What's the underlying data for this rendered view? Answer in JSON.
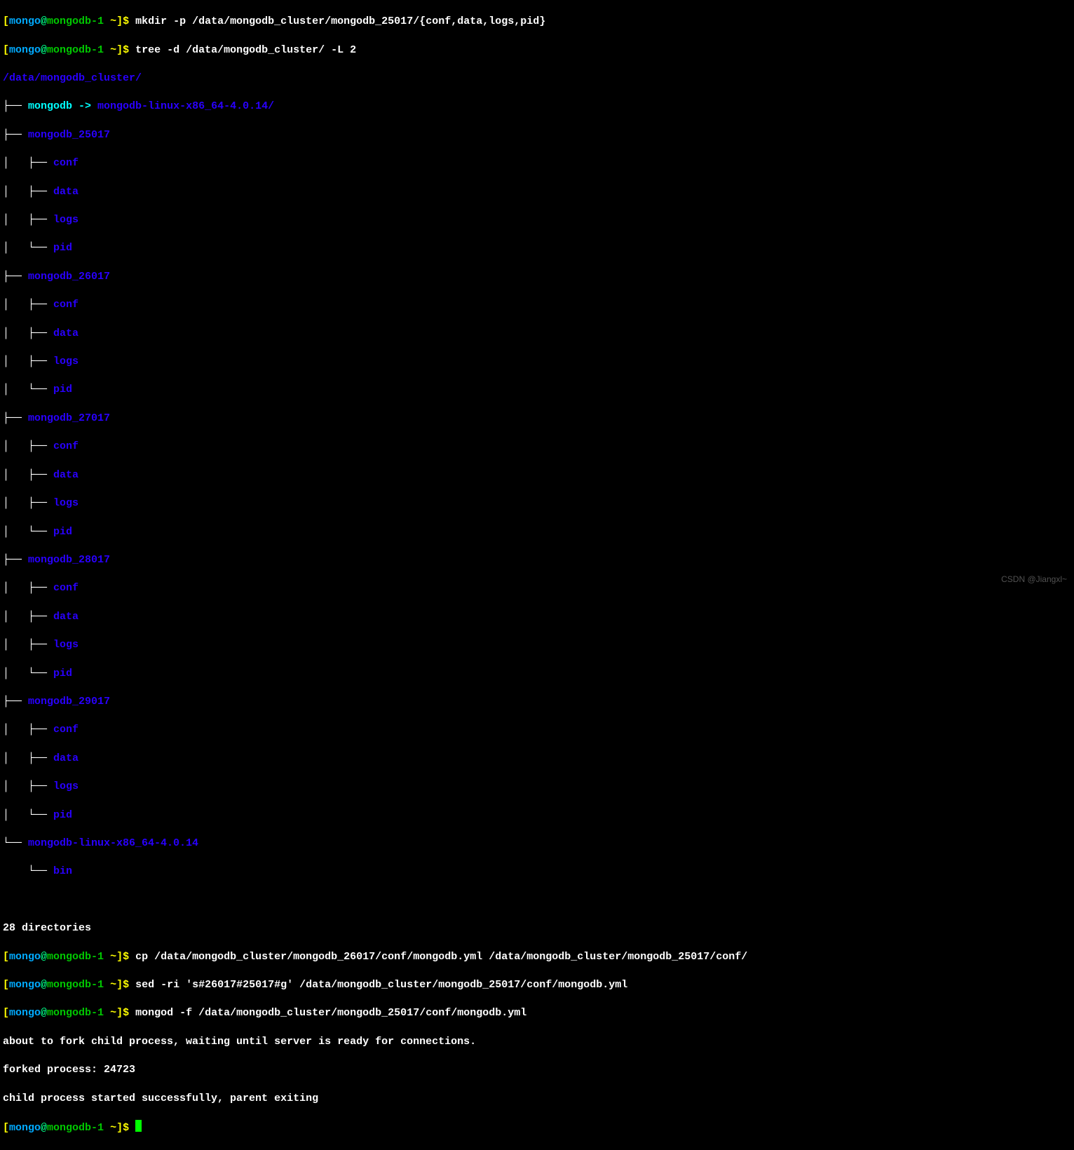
{
  "prompt": {
    "open_bracket": "[",
    "user": "mongo",
    "at": "@",
    "host": "mongodb-1",
    "path": " ~",
    "close_bracket": "]",
    "dollar": "$"
  },
  "commands": {
    "mkdir": "mkdir -p /data/mongodb_cluster/mongodb_25017/{conf,data,logs,pid}",
    "tree": "tree -d /data/mongodb_cluster/ -L 2",
    "cp": "cp /data/mongodb_cluster/mongodb_26017/conf/mongodb.yml /data/mongodb_cluster/mongodb_25017/conf/",
    "sed": "sed -ri 's#26017#25017#g' /data/mongodb_cluster/mongodb_25017/conf/mongodb.yml",
    "mongod": "mongod -f /data/mongodb_cluster/mongodb_25017/conf/mongodb.yml"
  },
  "tree_output": {
    "root": "/data/mongodb_cluster/",
    "symlink_name": "mongodb",
    "symlink_arrow": " -> ",
    "symlink_target": "mongodb-linux-x86_64-4.0.14/",
    "dir1": "mongodb_25017",
    "dir2": "mongodb_26017",
    "dir3": "mongodb_27017",
    "dir4": "mongodb_28017",
    "dir5": "mongodb_29017",
    "dir6": "mongodb-linux-x86_64-4.0.14",
    "sub_conf": "conf",
    "sub_data": "data",
    "sub_logs": "logs",
    "sub_pid": "pid",
    "sub_bin": "bin",
    "summary": "28 directories"
  },
  "mongod_output": {
    "line1": "about to fork child process, waiting until server is ready for connections.",
    "line2": "forked process: 24723",
    "line3": "child process started successfully, parent exiting"
  },
  "watermark": "CSDN @Jiangxl~"
}
